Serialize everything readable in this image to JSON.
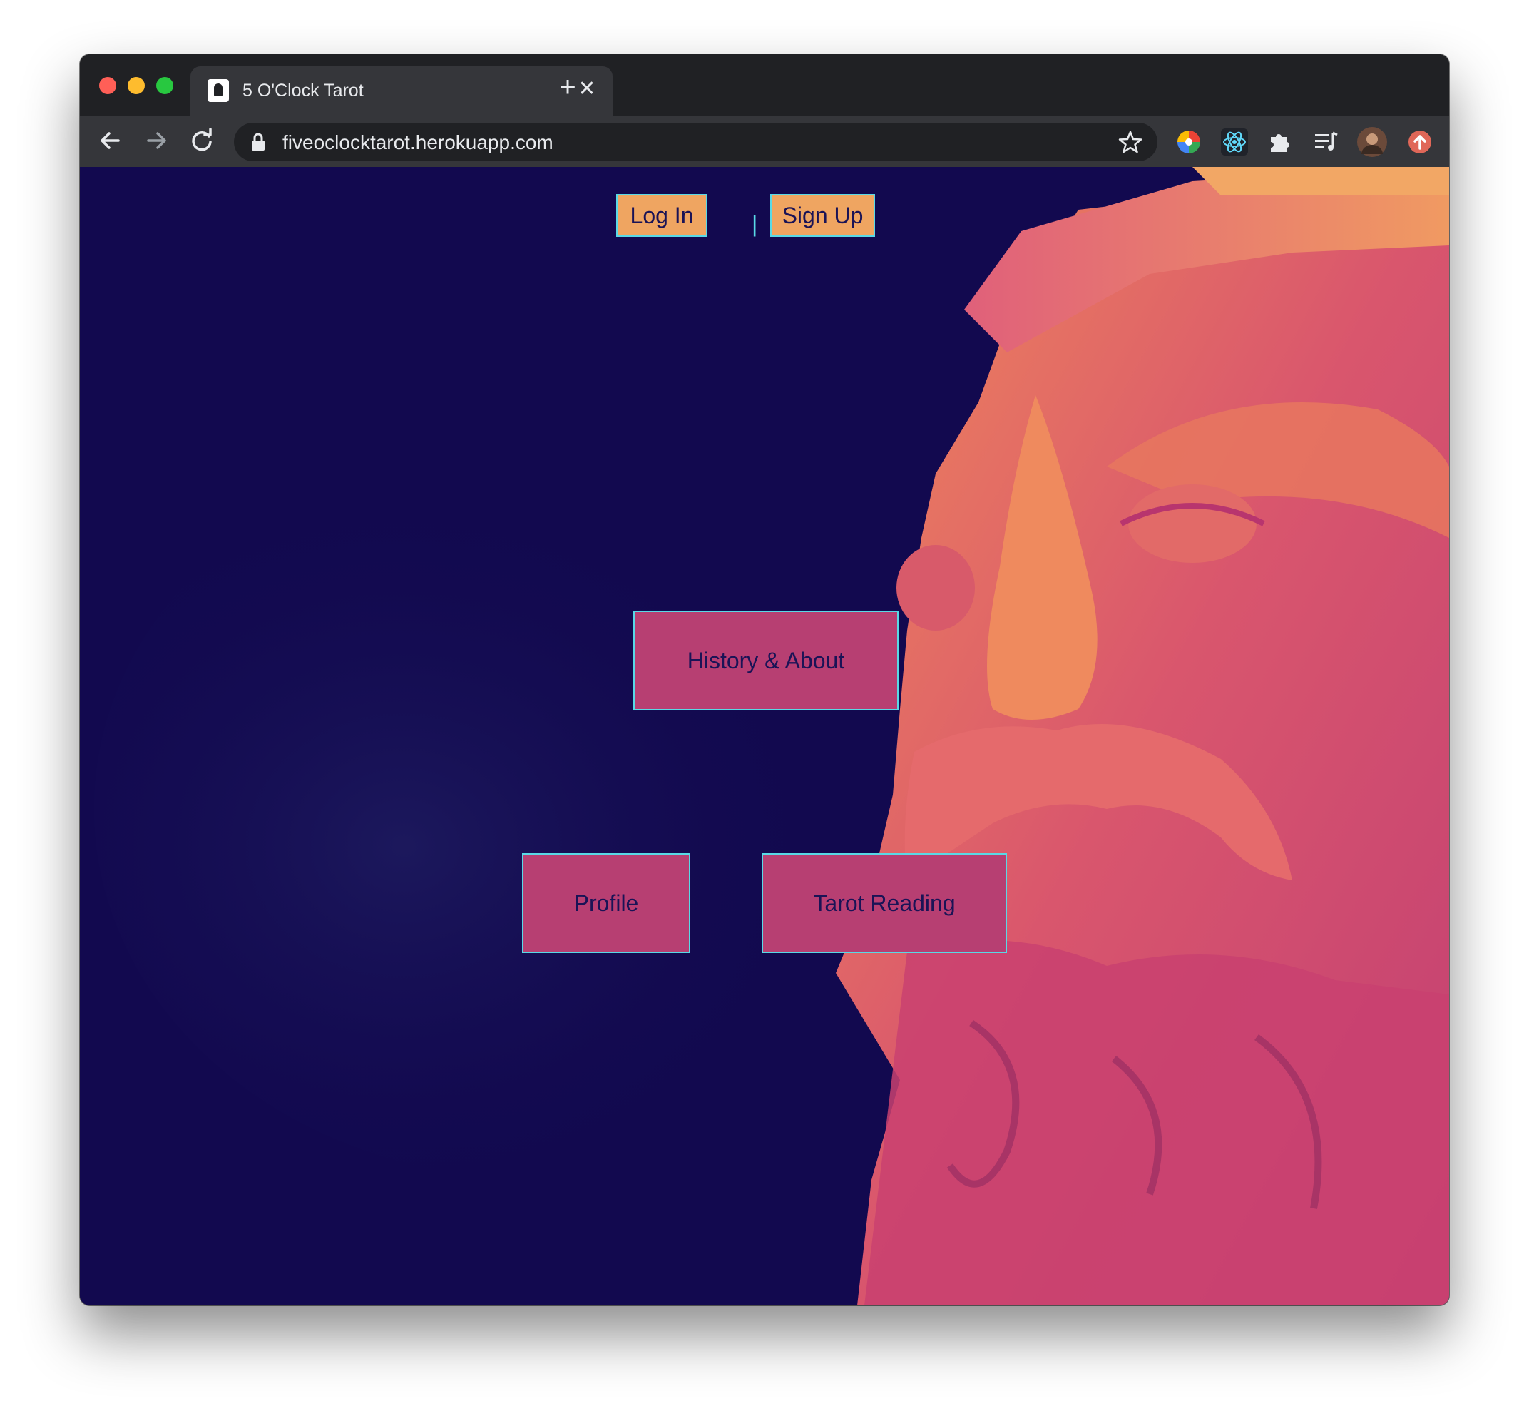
{
  "browser": {
    "tab_title": "5 O'Clock Tarot",
    "tab_close": "✕",
    "new_tab": "+",
    "url": "fiveoclocktarot.herokuapp.com"
  },
  "nav": {
    "login_label": "Log In",
    "separator": "|",
    "signup_label": "Sign Up"
  },
  "menu": {
    "history_label": "History & About",
    "profile_label": "Profile",
    "tarot_label": "Tarot Reading"
  },
  "colors": {
    "background": "#12094f",
    "orange_button": "#efa561",
    "pink_button": "#b73f72",
    "button_border": "#59d9e6",
    "button_text": "#1a1356"
  }
}
